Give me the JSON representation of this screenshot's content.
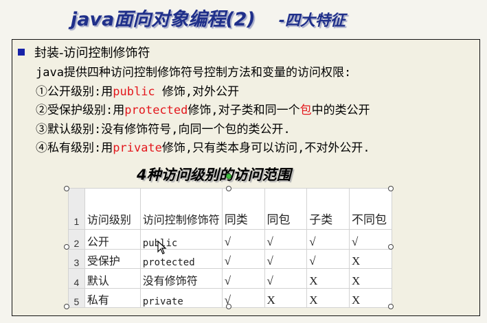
{
  "slide": {
    "title": "java面向对象编程(2)",
    "subtitle": "-四大特征"
  },
  "section": {
    "heading": "封装-访问控制修饰符",
    "lines": [
      [
        "java提供四种访问控制修饰符号控制方法和变量的访问权限:"
      ],
      [
        "①公开级别:用",
        "public",
        " 修饰,对外公开"
      ],
      [
        "②受保护级别:用",
        "protected",
        "修饰,对子类和同一个",
        "包",
        "中的类公开"
      ],
      [
        "③默认级别:没有修饰符号,向同一个包的类公开."
      ],
      [
        "④私有级别:用",
        "private",
        "修饰,只有类本身可以访问,不对外公开."
      ]
    ]
  },
  "table": {
    "title": "4种访问级别的访问范围",
    "row_numbers": [
      "1",
      "2",
      "3",
      "4",
      "5"
    ],
    "headers": [
      "访问级别",
      "访问控制修饰符",
      "同类",
      "同包",
      "子类",
      "不同包"
    ],
    "rows": [
      [
        "公开",
        "public",
        "√",
        "√",
        "√",
        "√"
      ],
      [
        "受保护",
        "protected",
        "√",
        "√",
        "√",
        "X"
      ],
      [
        "默认",
        "没有修饰符",
        "√",
        "√",
        "X",
        "X"
      ],
      [
        "私有",
        "private",
        "√",
        "X",
        "X",
        "X"
      ]
    ]
  },
  "icons": {
    "bullet": "square-bullet-icon",
    "cursor": "mouse-pointer-icon"
  },
  "colors": {
    "title": "#1f2f8a",
    "bullet": "#1722a8",
    "keyword": "#e3171c"
  }
}
